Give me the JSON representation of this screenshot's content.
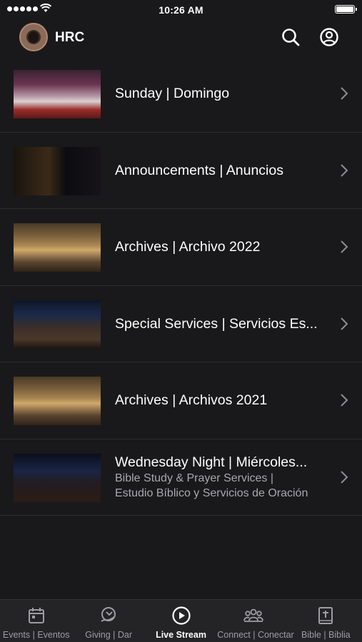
{
  "status_bar": {
    "time": "10:26 AM"
  },
  "header": {
    "title": "HRC"
  },
  "items": [
    {
      "title": "Sunday | Domingo",
      "subtitle": ""
    },
    {
      "title": "Announcements | Anuncios",
      "subtitle": ""
    },
    {
      "title": "Archives | Archivo 2022",
      "subtitle": ""
    },
    {
      "title": "Special Services | Servicios Es...",
      "subtitle": ""
    },
    {
      "title": "Archives | Archivos 2021",
      "subtitle": ""
    },
    {
      "title": "Wednesday Night | Miércoles...",
      "subtitle_lines": [
        "Bible Study & Prayer Services |",
        "Estudio Bíblico y Servicios de Oración"
      ]
    }
  ],
  "tabs": [
    {
      "label": "Events | Eventos",
      "icon": "calendar-icon"
    },
    {
      "label": "Giving | Dar",
      "icon": "giving-icon"
    },
    {
      "label": "Live Stream",
      "icon": "play-icon",
      "active": true
    },
    {
      "label": "Connect | Conectar",
      "icon": "people-icon"
    },
    {
      "label": "Bible | Biblia",
      "icon": "bible-icon"
    }
  ],
  "colors": {
    "background": "#19191b",
    "tab_bar": "#242427",
    "active": "#ffffff",
    "inactive": "#9d9da2"
  }
}
